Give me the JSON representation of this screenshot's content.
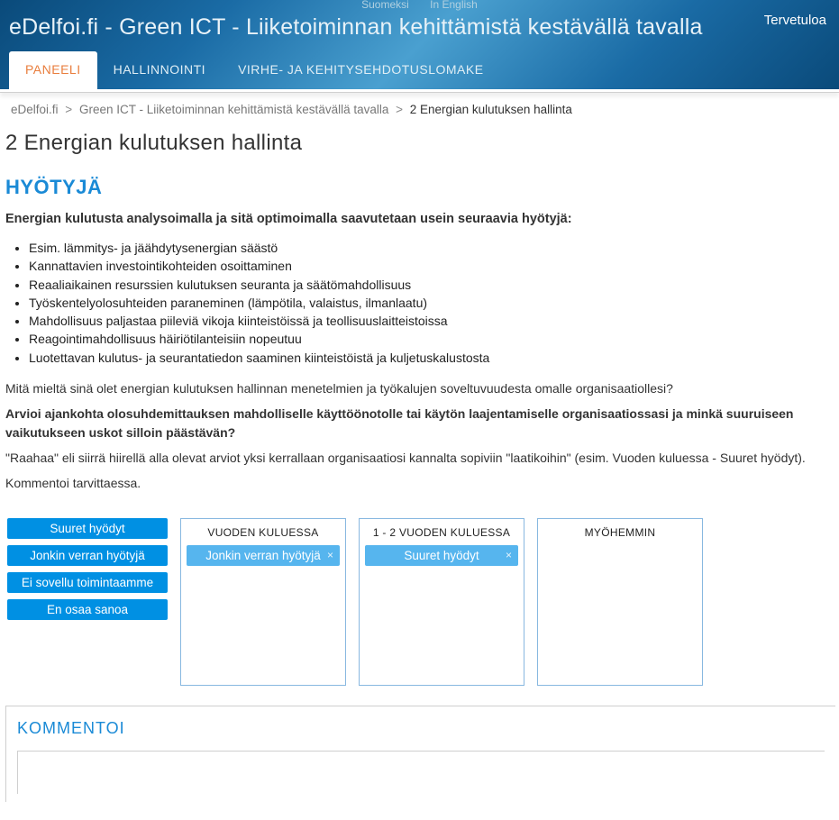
{
  "lang": {
    "fi": "Suomeksi",
    "en": "In English"
  },
  "welcome": "Tervetuloa",
  "site_title": "eDelfoi.fi - Green ICT - Liiketoiminnan kehittämistä kestävällä tavalla",
  "nav": {
    "paneeli": "PANEELI",
    "hallinnointi": "HALLINNOINTI",
    "virhe": "VIRHE- JA KEHITYSEHDOTUSLOMAKE"
  },
  "breadcrumb": {
    "home": "eDelfoi.fi",
    "project": "Green ICT - Liiketoiminnan kehittämistä kestävällä tavalla",
    "current": "2 Energian kulutuksen hallinta",
    "sep": ">"
  },
  "page_title": "2 Energian kulutuksen hallinta",
  "section_h": "HYÖTYJÄ",
  "intro_bold": "Energian kulutusta analysoimalla ja sitä optimoimalla saavutetaan usein seuraavia hyötyjä:",
  "benefits": [
    "Esim. lämmitys- ja jäähdytysenergian säästö",
    "Kannattavien investointikohteiden osoittaminen",
    "Reaaliaikainen resurssien kulutuksen seuranta ja säätömahdollisuus",
    "Työskentelyolosuhteiden paraneminen (lämpötila, valaistus, ilmanlaatu)",
    "Mahdollisuus paljastaa piileviä vikoja kiinteistöissä ja teollisuuslaitteistoissa",
    "Reagointimahdollisuus häiriötilanteisiin nopeutuu",
    "Luotettavan kulutus- ja seurantatiedon saaminen kiinteistöistä ja kuljetuskalustosta"
  ],
  "q1": "Mitä mieltä sinä olet energian kulutuksen hallinnan menetelmien ja työkalujen soveltuvuudesta omalle organisaatiollesi?",
  "q2": "Arvioi ajankohta olosuhdemittauksen mahdolliselle käyttöönotolle tai käytön laajentamiselle organisaatiossasi ja minkä suuruiseen vaikutukseen uskot silloin päästävän?",
  "q3": "\"Raahaa\" eli siirrä hiirellä alla olevat arviot yksi kerrallaan organisaatiosi kannalta sopiviin \"laatikoihin\" (esim. Vuoden kuluessa - Suuret hyödyt).",
  "q4": "Kommentoi tarvittaessa.",
  "source": {
    "suuret": "Suuret hyödyt",
    "jonkin": "Jonkin verran hyötyjä",
    "ei_sovellu": "Ei sovellu toimintaamme",
    "en_osaa": "En osaa sanoa"
  },
  "columns": {
    "c1": {
      "title": "VUODEN KULUESSA",
      "chip": "Jonkin verran hyötyjä"
    },
    "c2": {
      "title": "1 - 2 VUODEN KULUESSA",
      "chip": "Suuret hyödyt"
    },
    "c3": {
      "title": "MYÖHEMMIN"
    }
  },
  "comment_title": "KOMMENTOI",
  "close_x": "×"
}
